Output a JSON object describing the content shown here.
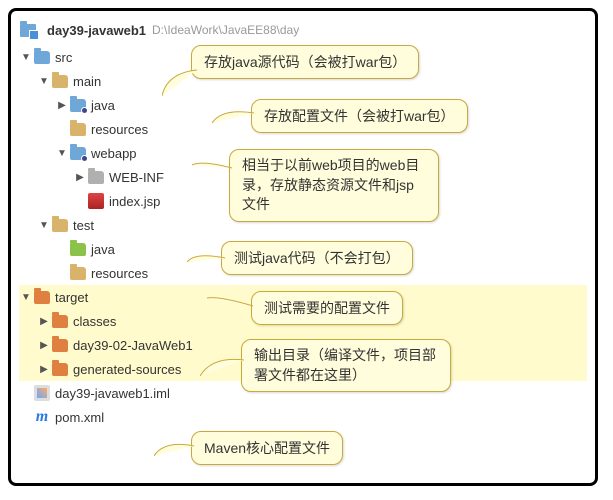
{
  "header": {
    "project_name": "day39-javaweb1",
    "project_path": "D:\\IdeaWork\\JavaEE88\\day"
  },
  "tree": {
    "src": "src",
    "main": "main",
    "java": "java",
    "resources": "resources",
    "webapp": "webapp",
    "web_inf": "WEB-INF",
    "index_jsp": "index.jsp",
    "test": "test",
    "test_java": "java",
    "test_resources": "resources",
    "target": "target",
    "classes": "classes",
    "day39_02": "day39-02-JavaWeb1",
    "gen_sources": "generated-sources",
    "iml": "day39-javaweb1.iml",
    "pom": "pom.xml"
  },
  "callouts": {
    "java_src": "存放java源代码（会被打war包）",
    "resources": "存放配置文件（会被打war包）",
    "webapp": "相当于以前web项目的web目录，存放静态资源文件和jsp文件",
    "test_java": "测试java代码（不会打包）",
    "test_resources": "测试需要的配置文件",
    "target": "输出目录（编译文件，项目部署文件都在这里）",
    "pom": "Maven核心配置文件"
  }
}
